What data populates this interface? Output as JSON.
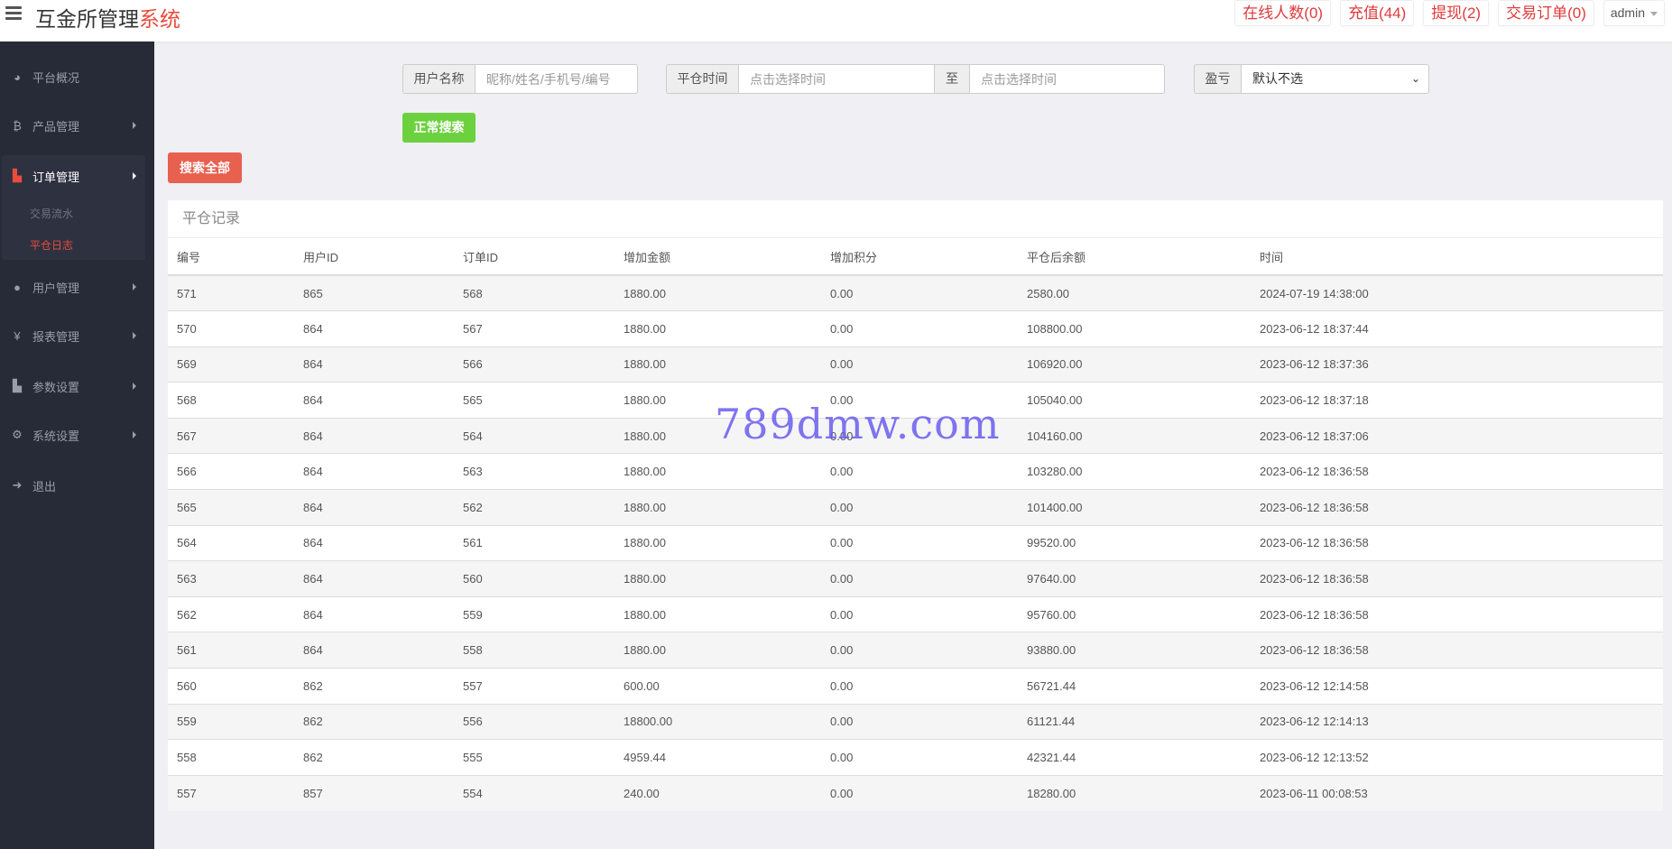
{
  "header": {
    "brand_main": "互金所管理",
    "brand_accent": "系统",
    "buttons": [
      "在线人数(0)",
      "充值(44)",
      "提现(2)",
      "交易订单(0)"
    ],
    "user": "admin"
  },
  "sidebar": {
    "items": [
      {
        "label": "平台概况",
        "icon": "dashboard-icon"
      },
      {
        "label": "产品管理",
        "icon": "bitcoin-icon"
      },
      {
        "label": "订单管理",
        "icon": "files-icon"
      },
      {
        "label": "用户管理",
        "icon": "user-icon"
      },
      {
        "label": "报表管理",
        "icon": "yen-icon"
      },
      {
        "label": "参数设置",
        "icon": "files-icon"
      },
      {
        "label": "系统设置",
        "icon": "gears-icon"
      },
      {
        "label": "退出",
        "icon": "sign-out-icon"
      }
    ],
    "sub_items": [
      "交易流水",
      "平仓日志"
    ]
  },
  "search": {
    "username_label": "用户名称",
    "username_placeholder": "昵称/姓名/手机号/编号",
    "time_label": "平仓时间",
    "time_start_placeholder": "点击选择时间",
    "to_label": "至",
    "time_end_placeholder": "点击选择时间",
    "pl_label": "盈亏",
    "pl_selected": "默认不选",
    "search_button": "正常搜索",
    "search_all_button": "搜索全部"
  },
  "panel": {
    "title": "平仓记录",
    "columns": [
      "编号",
      "用户ID",
      "订单ID",
      "增加金额",
      "增加积分",
      "平仓后余额",
      "时间"
    ],
    "rows": [
      [
        "571",
        "865",
        "568",
        "1880.00",
        "0.00",
        "2580.00",
        "2024-07-19 14:38:00"
      ],
      [
        "570",
        "864",
        "567",
        "1880.00",
        "0.00",
        "108800.00",
        "2023-06-12 18:37:44"
      ],
      [
        "569",
        "864",
        "566",
        "1880.00",
        "0.00",
        "106920.00",
        "2023-06-12 18:37:36"
      ],
      [
        "568",
        "864",
        "565",
        "1880.00",
        "0.00",
        "105040.00",
        "2023-06-12 18:37:18"
      ],
      [
        "567",
        "864",
        "564",
        "1880.00",
        "0.00",
        "104160.00",
        "2023-06-12 18:37:06"
      ],
      [
        "566",
        "864",
        "563",
        "1880.00",
        "0.00",
        "103280.00",
        "2023-06-12 18:36:58"
      ],
      [
        "565",
        "864",
        "562",
        "1880.00",
        "0.00",
        "101400.00",
        "2023-06-12 18:36:58"
      ],
      [
        "564",
        "864",
        "561",
        "1880.00",
        "0.00",
        "99520.00",
        "2023-06-12 18:36:58"
      ],
      [
        "563",
        "864",
        "560",
        "1880.00",
        "0.00",
        "97640.00",
        "2023-06-12 18:36:58"
      ],
      [
        "562",
        "864",
        "559",
        "1880.00",
        "0.00",
        "95760.00",
        "2023-06-12 18:36:58"
      ],
      [
        "561",
        "864",
        "558",
        "1880.00",
        "0.00",
        "93880.00",
        "2023-06-12 18:36:58"
      ],
      [
        "560",
        "862",
        "557",
        "600.00",
        "0.00",
        "56721.44",
        "2023-06-12 12:14:58"
      ],
      [
        "559",
        "862",
        "556",
        "18800.00",
        "0.00",
        "61121.44",
        "2023-06-12 12:14:13"
      ],
      [
        "558",
        "862",
        "555",
        "4959.44",
        "0.00",
        "42321.44",
        "2023-06-12 12:13:52"
      ],
      [
        "557",
        "857",
        "554",
        "240.00",
        "0.00",
        "18280.00",
        "2023-06-11 00:08:53"
      ]
    ]
  },
  "watermark": "789dmw.com",
  "colors": {
    "accent": "#e84c3d",
    "green": "#6cd13f",
    "sidebar": "#272a37"
  }
}
